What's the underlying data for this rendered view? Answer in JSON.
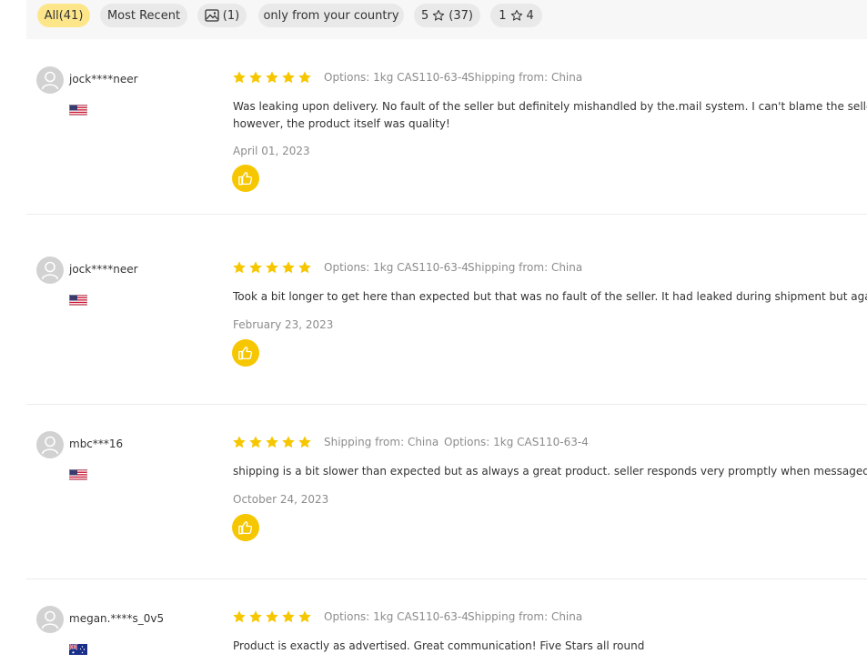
{
  "filters": [
    {
      "label": "All(41)",
      "active": true
    },
    {
      "label": "Most Recent",
      "active": false
    },
    {
      "label": "(1)",
      "icon": "image-icon",
      "active": false
    },
    {
      "label": "only from your country",
      "active": false
    },
    {
      "label": "5",
      "icon": "star-outline-icon",
      "count": "(37)",
      "active": false
    },
    {
      "label": "1",
      "icon": "star-outline-icon",
      "count": "4",
      "active": false
    }
  ],
  "colors": {
    "star": "#f6c700",
    "like": "#f6c700",
    "active_chip": "#fde68a"
  },
  "reviews": [
    {
      "username": "jock****neer",
      "country_flag": "us-flag-icon",
      "rating": 5,
      "meta": [
        "Options: 1kg CAS110-63-4",
        "Shipping from: China"
      ],
      "text_lines": [
        "Was leaking upon delivery. No fault of the seller but definitely mishandled by the.mail system. I can't blame the seller for mis",
        "however, the product itself was quality!"
      ],
      "date": "April 01, 2023"
    },
    {
      "username": "jock****neer",
      "country_flag": "us-flag-icon",
      "rating": 5,
      "meta": [
        "Options: 1kg CAS110-63-4",
        "Shipping from: China"
      ],
      "text_lines": [
        "Took a bit longer to get here than expected but that was no fault of the seller. It had leaked during shipment but again not th"
      ],
      "date": "February 23, 2023"
    },
    {
      "username": "mbc***16",
      "country_flag": "us-flag-icon",
      "rating": 5,
      "meta": [
        "Shipping from: China",
        "Options: 1kg CAS110-63-4"
      ],
      "text_lines": [
        "shipping is a bit slower than expected but as always a great product. seller responds very promptly when messaged."
      ],
      "date": "October 24, 2023"
    },
    {
      "username": "megan.****s_0v5",
      "country_flag": "au-flag-icon",
      "rating": 5,
      "meta": [
        "Options: 1kg CAS110-63-4",
        "Shipping from: China"
      ],
      "text_lines": [
        "Product is exactly as advertised. Great communication! Five Stars all round"
      ],
      "date": ""
    }
  ]
}
